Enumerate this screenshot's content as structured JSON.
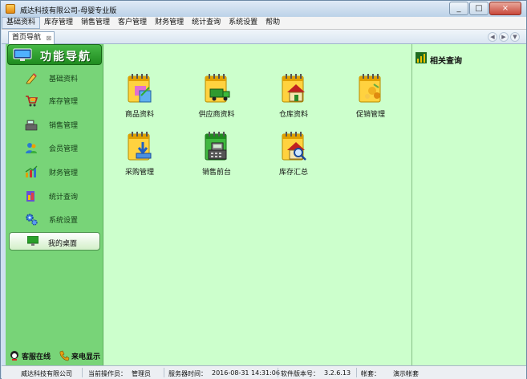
{
  "window": {
    "title": "威达科技有限公司-母婴专业版",
    "buttons": [
      "_",
      "□",
      "×"
    ]
  },
  "menu": [
    "基础资料",
    "库存管理",
    "销售管理",
    "客户管理",
    "财务管理",
    "统计查询",
    "系统设置",
    "帮助"
  ],
  "tab": {
    "label": "首页导航",
    "close": "⊠"
  },
  "sidebar": {
    "title": "功能导航",
    "items": [
      {
        "label": "基础资料",
        "icon": "pencil-icon"
      },
      {
        "label": "库存管理",
        "icon": "cart-icon"
      },
      {
        "label": "销售管理",
        "icon": "cash-register-icon"
      },
      {
        "label": "会员管理",
        "icon": "members-icon"
      },
      {
        "label": "财务管理",
        "icon": "finance-chart-icon"
      },
      {
        "label": "统计查询",
        "icon": "statistics-icon"
      },
      {
        "label": "系统设置",
        "icon": "gears-icon"
      }
    ],
    "desktop": "我的桌面",
    "footer": {
      "online": "客服在线",
      "caller": "来电显示"
    }
  },
  "functions": [
    {
      "label": "商品资料",
      "icon": "product-notepad-icon"
    },
    {
      "label": "供应商资料",
      "icon": "supplier-truck-icon"
    },
    {
      "label": "仓库资料",
      "icon": "warehouse-house-icon"
    },
    {
      "label": "促销管理",
      "icon": "promotion-icon"
    },
    {
      "label": "采购管理",
      "icon": "purchase-download-icon"
    },
    {
      "label": "销售前台",
      "icon": "pos-register-icon"
    },
    {
      "label": "库存汇总",
      "icon": "inventory-search-icon"
    }
  ],
  "right_panel": {
    "title": "相关查询"
  },
  "statusbar": {
    "company": "威达科技有限公司",
    "operator_label": "当前操作员：",
    "operator": "管理员",
    "server_time_label": "服务器时间：",
    "server_time": "2016-08-31 14:31:06",
    "version_label": "软件版本号：",
    "version": "3.2.6.13",
    "account_label": "帐套：",
    "account": "演示帐套"
  },
  "colors": {
    "sidebar_bg": "#78d478",
    "main_bg": "#ccffcc",
    "header_green": "#2a9a2a"
  }
}
